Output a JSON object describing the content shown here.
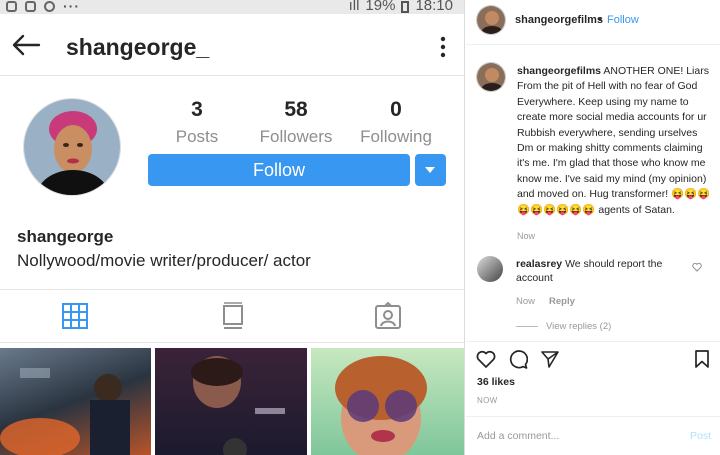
{
  "statusbar": {
    "battery": "19%",
    "time": "18:10",
    "dots": "···"
  },
  "header": {
    "username": "shangeorge_"
  },
  "profile": {
    "stats": [
      {
        "num": "3",
        "label": "Posts"
      },
      {
        "num": "58",
        "label": "Followers"
      },
      {
        "num": "0",
        "label": "Following"
      }
    ],
    "follow_label": "Follow",
    "name": "shangeorge",
    "bio": "Nollywood/movie writer/producer/ actor"
  },
  "colors": {
    "accent": "#3897f0",
    "muted": "#8e8e8e"
  },
  "post": {
    "user": "shangeorgefilms",
    "dot": "•",
    "follow": "Follow",
    "caption_user": "shangeorgefilms",
    "caption_text": "ANOTHER ONE! Liars From the pit of Hell with no fear of God Everywhere. Keep using my name to create more social media accounts for ur Rubbish everywhere, sending urselves Dm or making shitty comments claiming it's me. I'm glad that those who know me know me. I've said my mind (my opinion) and moved on. Hug transformer! 😝😝😝😝😝😝😝😝😝 agents of Satan.",
    "caption_time": "Now",
    "comment_user": "realasrey",
    "comment_text": "We should report the account",
    "comment_time": "Now",
    "comment_reply": "Reply",
    "view_replies": "View replies (2)",
    "likes": "36 likes",
    "time": "NOW",
    "add_comment": "Add a comment...",
    "post_button": "Post"
  }
}
